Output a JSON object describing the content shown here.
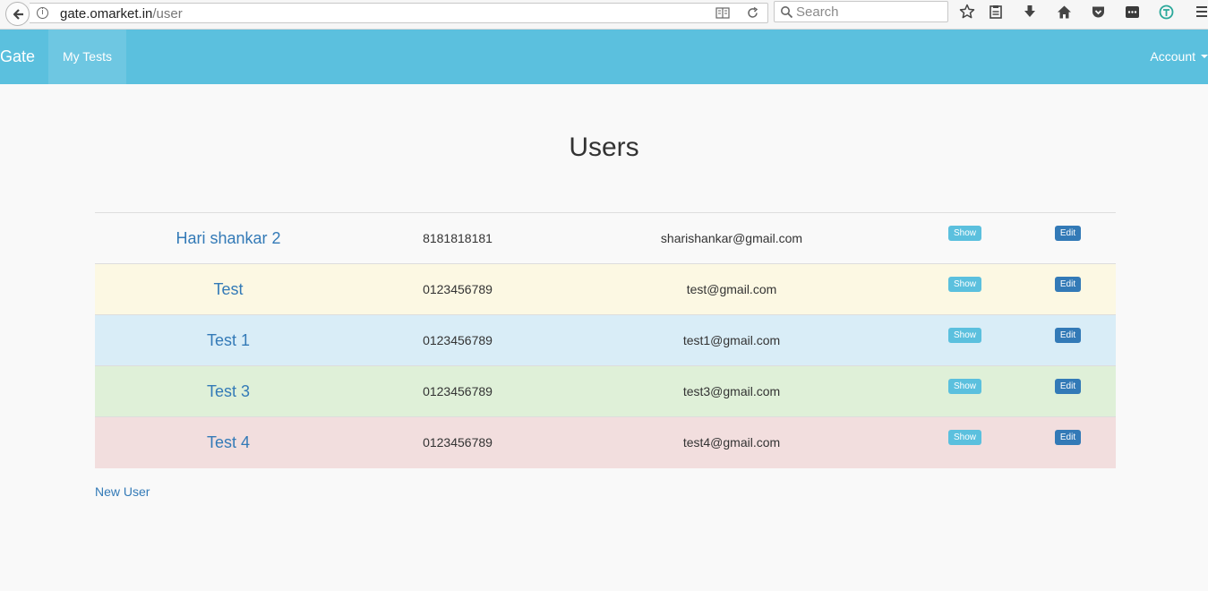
{
  "browser": {
    "url_host": "gate.omarket.in",
    "url_path": "/user",
    "search_placeholder": "Search"
  },
  "navbar": {
    "brand": "Gate",
    "active_item": "My Tests",
    "account": "Account",
    "color": "#5bc0de"
  },
  "page": {
    "title": "Users",
    "new_user": "New User"
  },
  "users": [
    {
      "name": "Hari shankar 2",
      "phone": "8181818181",
      "email": "sharishankar@gmail.com",
      "show": "Show",
      "edit": "Edit"
    },
    {
      "name": "Test",
      "phone": "0123456789",
      "email": "test@gmail.com",
      "show": "Show",
      "edit": "Edit"
    },
    {
      "name": "Test 1",
      "phone": "0123456789",
      "email": "test1@gmail.com",
      "show": "Show",
      "edit": "Edit"
    },
    {
      "name": "Test 3",
      "phone": "0123456789",
      "email": "test3@gmail.com",
      "show": "Show",
      "edit": "Edit"
    },
    {
      "name": "Test 4",
      "phone": "0123456789",
      "email": "test4@gmail.com",
      "show": "Show",
      "edit": "Edit"
    }
  ]
}
